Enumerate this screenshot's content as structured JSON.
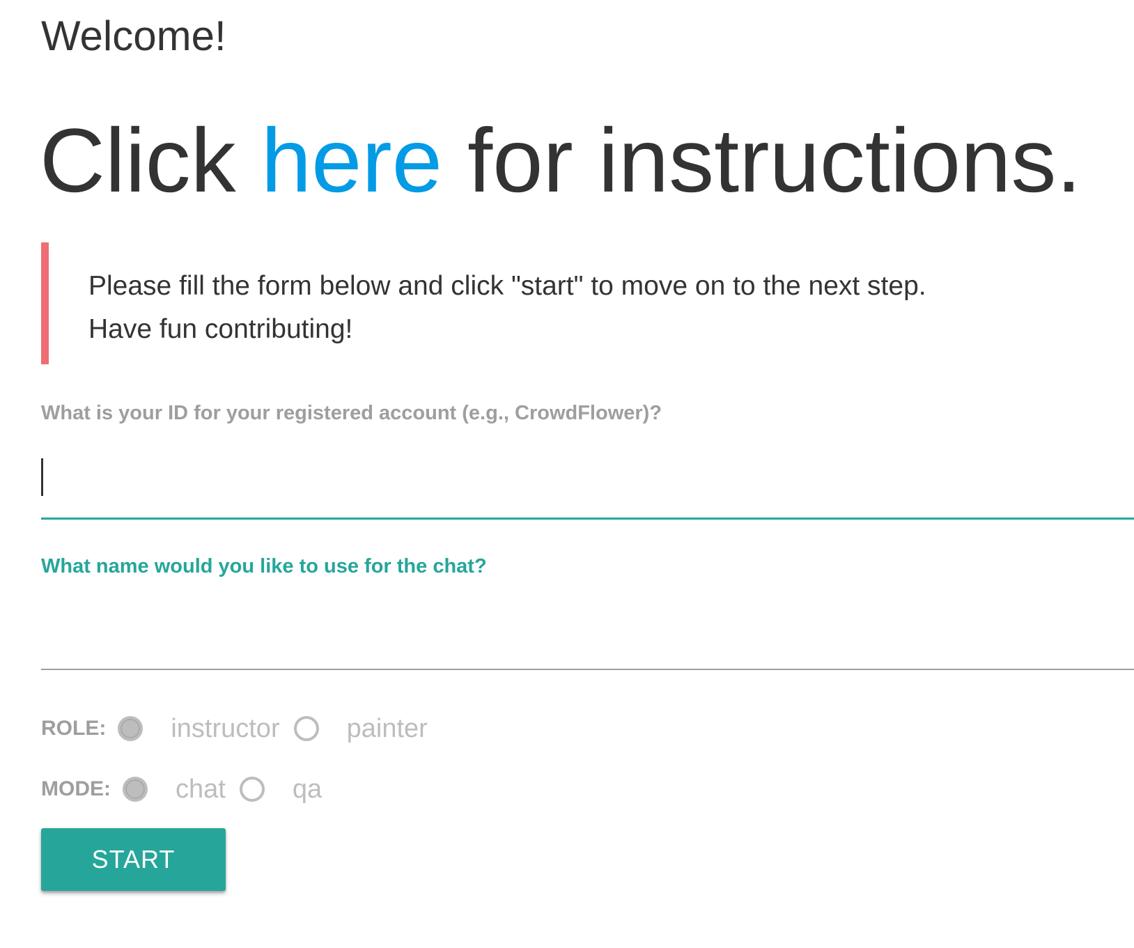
{
  "page": {
    "welcome": "Welcome!",
    "headline": {
      "prefix": "Click ",
      "link": "here",
      "suffix": " for instructions."
    },
    "notice": {
      "line1": "Please fill the form below and click \"start\" to move on to the next step.",
      "line2": "Have fun contributing!"
    }
  },
  "form": {
    "id_label": "What is your ID for your registered account (e.g., CrowdFlower)?",
    "id_value": "",
    "name_label": "What name would you like to use for the chat?",
    "name_value": "",
    "role": {
      "label": "ROLE:",
      "options": [
        "instructor",
        "painter"
      ],
      "selected": "instructor"
    },
    "mode": {
      "label": "MODE:",
      "options": [
        "chat",
        "qa"
      ],
      "selected": "chat"
    },
    "start_label": "START"
  },
  "colors": {
    "accent": "#26a69a",
    "link": "#039be5",
    "notice_border": "#ee6e73",
    "muted": "#9e9e9e"
  }
}
